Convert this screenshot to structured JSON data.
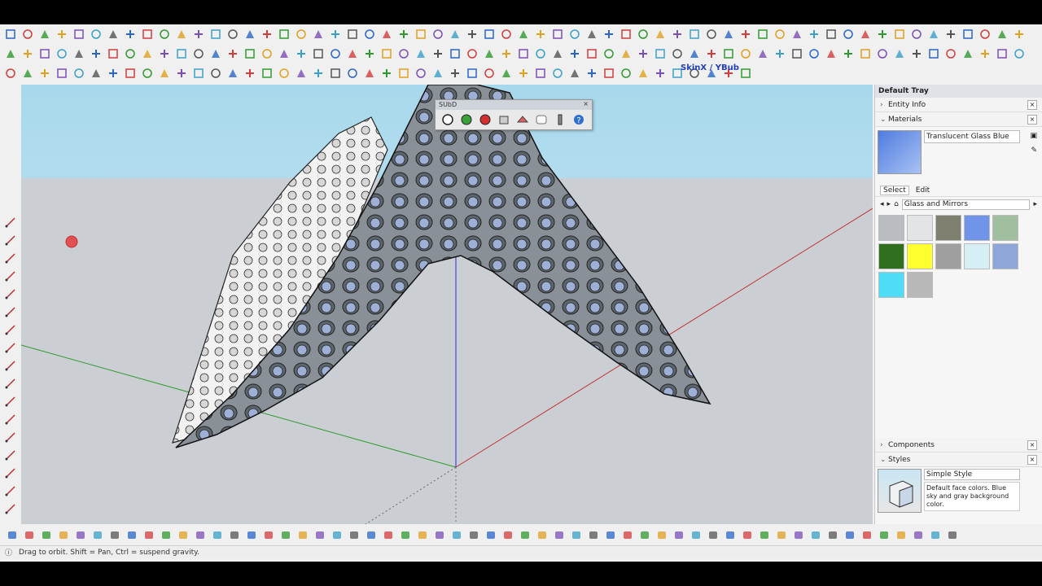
{
  "subd_toolbar": {
    "title": "SUbD"
  },
  "toolbar_plugin_label": "SkinX / YBub",
  "tray": {
    "title": "Default Tray",
    "entity_info": "Entity Info",
    "materials": {
      "label": "Materials",
      "current_name": "Translucent Glass Blue",
      "tab_select": "Select",
      "tab_edit": "Edit",
      "library": "Glass and Mirrors",
      "swatches": [
        "#b9bdc1",
        "#e2e4e6",
        "#7f7f6f",
        "#6f94e8",
        "#9fbf9f",
        "#2f6f1f",
        "#ffff2f",
        "#9f9f9f",
        "#d6eef6",
        "#8fa6d8",
        "#4fdcf6",
        "#b8b8b8"
      ]
    },
    "components": "Components",
    "styles": {
      "label": "Styles",
      "name": "Simple Style",
      "description": "Default face colors. Blue sky and gray background color."
    }
  },
  "status": {
    "message": "Drag to orbit. Shift = Pan, Ctrl = suspend gravity."
  },
  "colors": {
    "sky": "#a8d8ec",
    "ground": "#cbcfd3",
    "axis_red": "#c03030",
    "axis_green": "#2f9a2f",
    "axis_blue": "#2a2ae0"
  }
}
